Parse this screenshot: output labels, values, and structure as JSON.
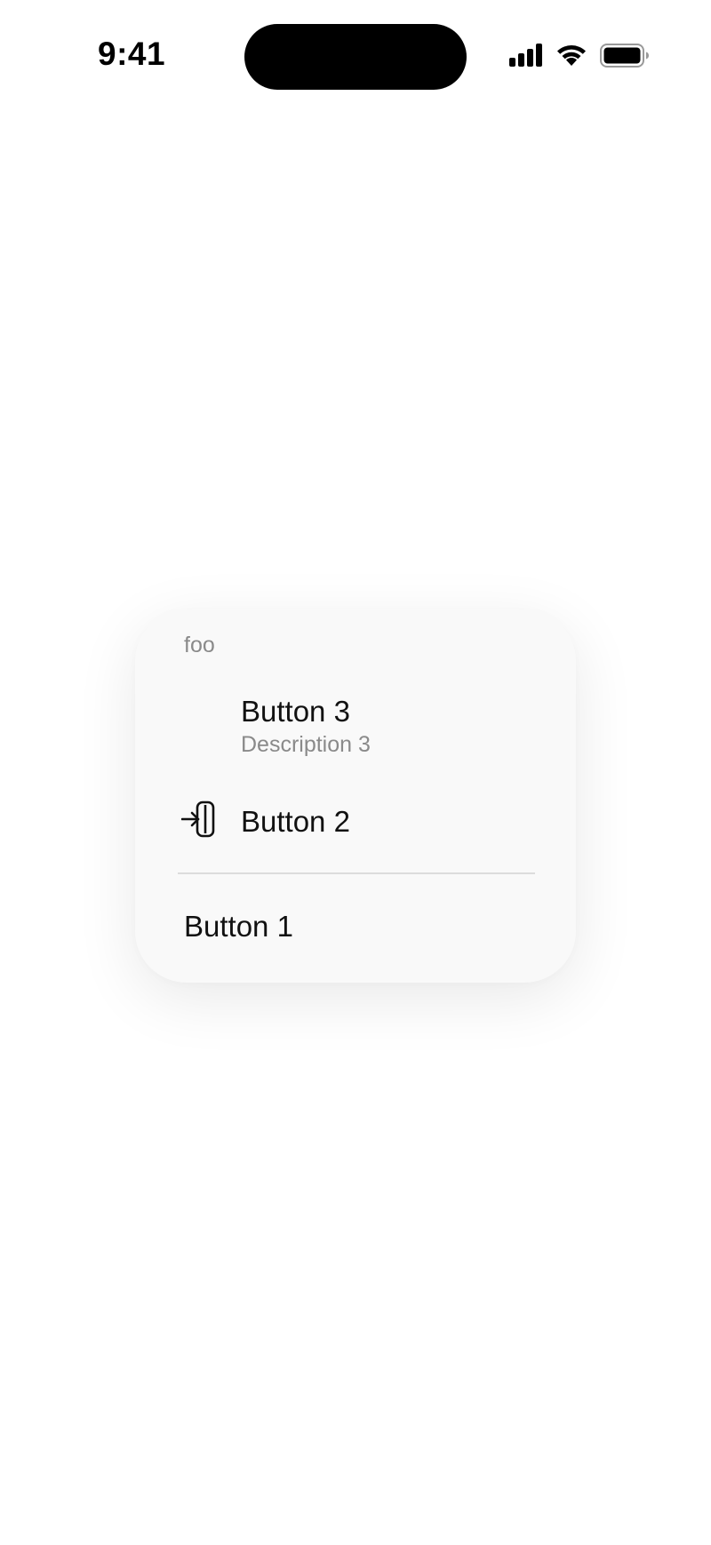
{
  "status_bar": {
    "time": "9:41",
    "icons": [
      "cellular-signal-icon",
      "wifi-icon",
      "battery-icon"
    ]
  },
  "menu": {
    "header": "foo",
    "items": [
      {
        "label": "Button 3",
        "description": "Description 3",
        "icon": null
      },
      {
        "label": "Button 2",
        "icon": "sign-in-icon"
      },
      {
        "label": "Button 1",
        "icon": null
      }
    ]
  },
  "colors": {
    "background": "#ffffff",
    "card": "#f9f9f9",
    "secondary_text": "#8a8a8a",
    "divider": "#dcdcdc"
  }
}
